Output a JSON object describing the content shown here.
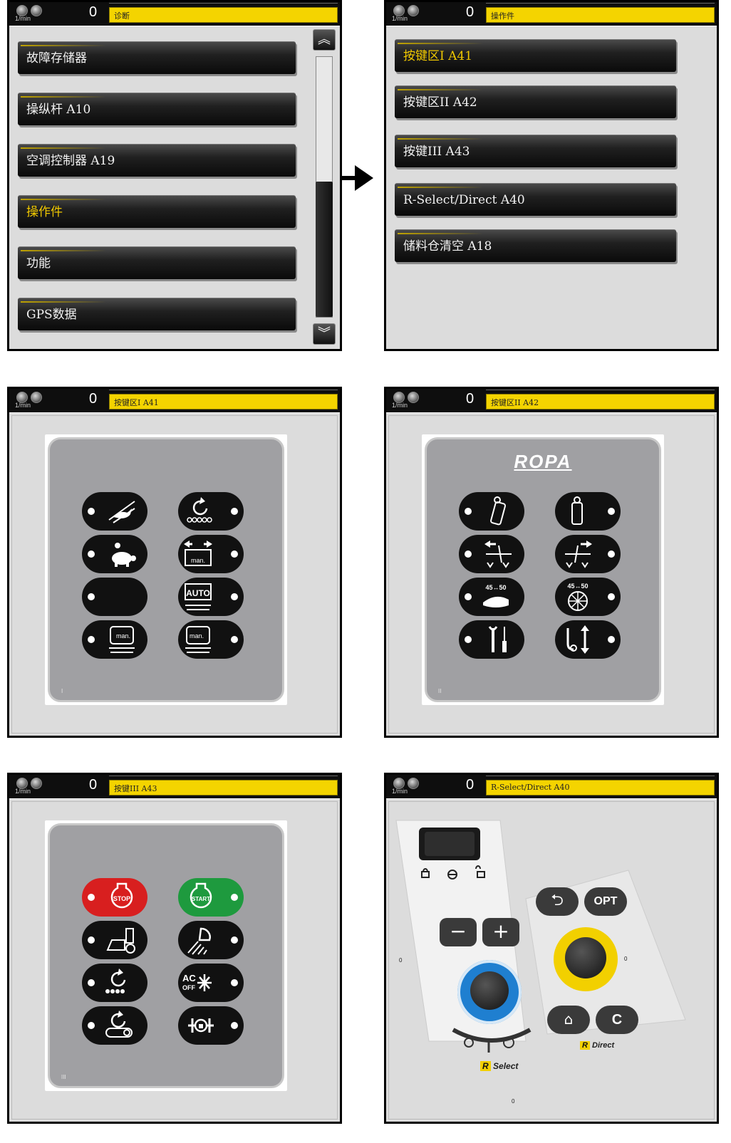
{
  "common": {
    "rpm_unit": "1/min",
    "rpm_value": "0"
  },
  "screens": [
    {
      "title": "诊断",
      "menu": [
        {
          "label": "故障存储器"
        },
        {
          "label": "操纵杆 A10"
        },
        {
          "label": "空调控制器 A19"
        },
        {
          "label": "操作件",
          "active": true
        },
        {
          "label": "功能"
        },
        {
          "label": "GPS数据"
        }
      ],
      "scroll_up_icon": "double-chevron-up-icon",
      "scroll_down_icon": "double-chevron-down-icon"
    },
    {
      "title": "操作件",
      "menu": [
        {
          "label": "按键区I A41",
          "active": true
        },
        {
          "label": "按键区II A42"
        },
        {
          "label": "按键III A43"
        },
        {
          "label": "R-Select/Direct A40"
        },
        {
          "label": "储料仓清空 A18"
        }
      ]
    },
    {
      "title": "按键区I A41",
      "panel_label": "I"
    },
    {
      "title": "按键区II A42",
      "panel_label": "II",
      "logo": "ROPA"
    },
    {
      "title": "按键III A43",
      "panel_label": "III"
    },
    {
      "title": "R-Select/Direct A40"
    }
  ],
  "a43_keys": [
    "STOP",
    "START"
  ],
  "a40": {
    "opt_label": "OPT",
    "c_label": "C",
    "select_brand": "Select",
    "direct_brand": "Direct",
    "zero": "0",
    "minus": "−",
    "plus": "+"
  },
  "colors": {
    "title_bar": "#f4d400",
    "active_text": "#f0c800",
    "stop": "#d81f1f",
    "start": "#1e9a3e",
    "select_ring": "#1f7fd0",
    "direct_ring": "#f2d000"
  }
}
